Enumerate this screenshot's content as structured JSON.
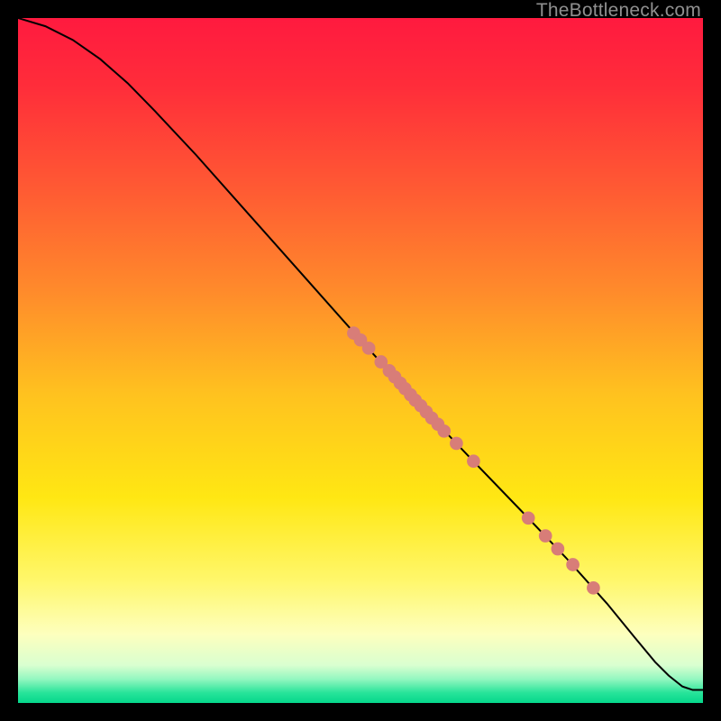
{
  "watermark": "TheBottleneck.com",
  "colors": {
    "gradient_stops": [
      {
        "offset": 0.0,
        "color": "#ff1a3f"
      },
      {
        "offset": 0.1,
        "color": "#ff2d3a"
      },
      {
        "offset": 0.25,
        "color": "#ff5a33"
      },
      {
        "offset": 0.4,
        "color": "#ff8b2b"
      },
      {
        "offset": 0.55,
        "color": "#ffc21f"
      },
      {
        "offset": 0.7,
        "color": "#ffe713"
      },
      {
        "offset": 0.82,
        "color": "#fff76a"
      },
      {
        "offset": 0.9,
        "color": "#fdffbe"
      },
      {
        "offset": 0.945,
        "color": "#d9ffd0"
      },
      {
        "offset": 0.965,
        "color": "#94f7c0"
      },
      {
        "offset": 0.985,
        "color": "#28e49a"
      },
      {
        "offset": 1.0,
        "color": "#05d78b"
      }
    ],
    "curve": "#000000",
    "marker_fill": "#d87d78",
    "marker_stroke": "#d87d78"
  },
  "chart_data": {
    "type": "line",
    "title": "",
    "xlabel": "",
    "ylabel": "",
    "xlim": [
      0,
      100
    ],
    "ylim": [
      0,
      100
    ],
    "series": [
      {
        "name": "curve",
        "x": [
          0,
          4,
          8,
          12,
          16,
          20,
          26,
          34,
          42,
          50,
          58,
          66,
          74,
          80,
          86,
          90,
          93,
          95,
          97,
          98.5,
          100
        ],
        "y": [
          100,
          98.8,
          96.8,
          94.0,
          90.5,
          86.4,
          80.0,
          71.0,
          62.0,
          53.0,
          44.2,
          35.8,
          27.5,
          21.2,
          14.5,
          9.6,
          6.0,
          4.0,
          2.4,
          1.9,
          1.9
        ]
      }
    ],
    "markers": [
      {
        "x": 49.0,
        "y": 54.0
      },
      {
        "x": 50.0,
        "y": 53.0
      },
      {
        "x": 51.2,
        "y": 51.8
      },
      {
        "x": 53.0,
        "y": 49.8
      },
      {
        "x": 54.2,
        "y": 48.5
      },
      {
        "x": 55.0,
        "y": 47.6
      },
      {
        "x": 55.8,
        "y": 46.7
      },
      {
        "x": 56.5,
        "y": 45.9
      },
      {
        "x": 57.3,
        "y": 45.0
      },
      {
        "x": 58.0,
        "y": 44.2
      },
      {
        "x": 58.8,
        "y": 43.4
      },
      {
        "x": 59.6,
        "y": 42.5
      },
      {
        "x": 60.4,
        "y": 41.6
      },
      {
        "x": 61.3,
        "y": 40.7
      },
      {
        "x": 62.2,
        "y": 39.7
      },
      {
        "x": 64.0,
        "y": 37.9
      },
      {
        "x": 66.5,
        "y": 35.3
      },
      {
        "x": 74.5,
        "y": 27.0
      },
      {
        "x": 77.0,
        "y": 24.4
      },
      {
        "x": 78.8,
        "y": 22.5
      },
      {
        "x": 81.0,
        "y": 20.2
      },
      {
        "x": 84.0,
        "y": 16.8
      }
    ],
    "marker_radius_data_units": 0.9
  }
}
